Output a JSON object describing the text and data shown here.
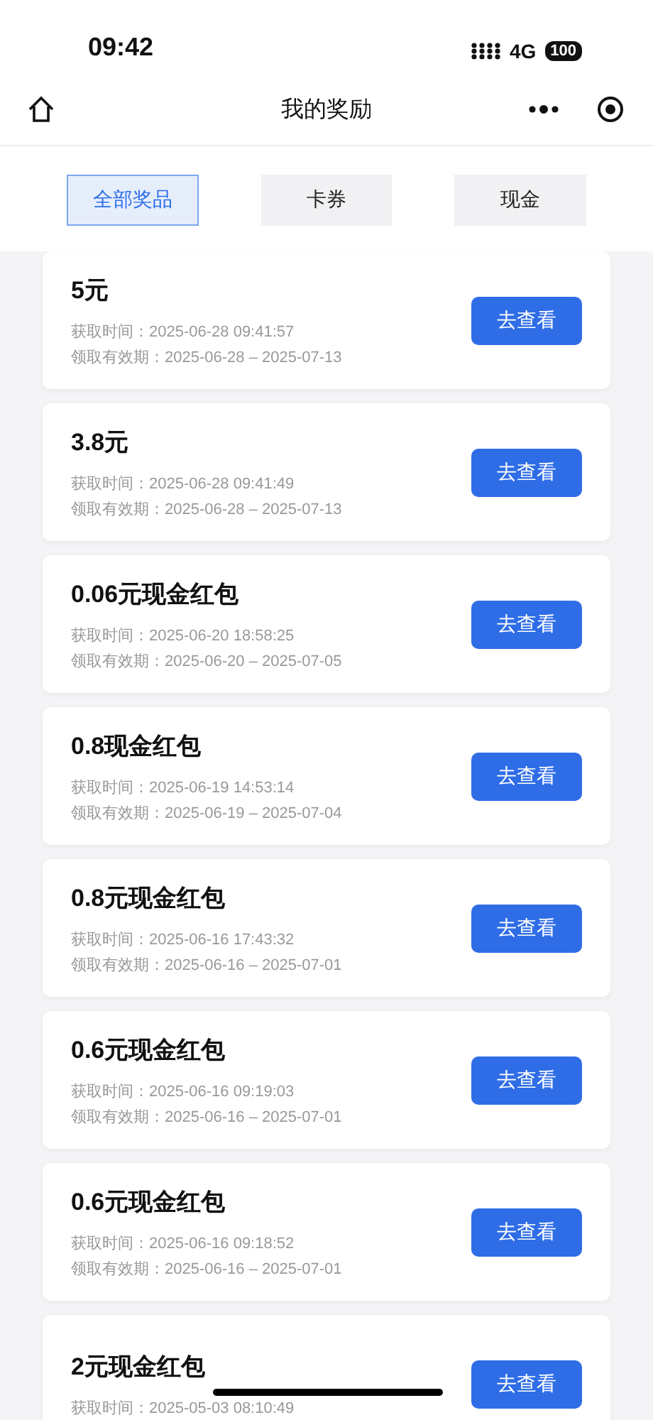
{
  "status_bar": {
    "time": "09:42",
    "network": "4G",
    "battery": "100"
  },
  "nav_bar": {
    "title": "我的奖励"
  },
  "tabs": [
    {
      "label": "全部奖品",
      "selected": true
    },
    {
      "label": "卡券",
      "selected": false
    },
    {
      "label": "现金",
      "selected": false
    }
  ],
  "rewards": [
    {
      "title": "5元",
      "obtained": "获取时间：2025-06-28 09:41:57",
      "validity": "领取有效期：2025-06-28 – 2025-07-13",
      "button": "去查看"
    },
    {
      "title": "3.8元",
      "obtained": "获取时间：2025-06-28 09:41:49",
      "validity": "领取有效期：2025-06-28 – 2025-07-13",
      "button": "去查看"
    },
    {
      "title": "0.06元现金红包",
      "obtained": "获取时间：2025-06-20 18:58:25",
      "validity": "领取有效期：2025-06-20 – 2025-07-05",
      "button": "去查看"
    },
    {
      "title": "0.8现金红包",
      "obtained": "获取时间：2025-06-19 14:53:14",
      "validity": "领取有效期：2025-06-19 – 2025-07-04",
      "button": "去查看"
    },
    {
      "title": "0.8元现金红包",
      "obtained": "获取时间：2025-06-16 17:43:32",
      "validity": "领取有效期：2025-06-16 – 2025-07-01",
      "button": "去查看"
    },
    {
      "title": "0.6元现金红包",
      "obtained": "获取时间：2025-06-16 09:19:03",
      "validity": "领取有效期：2025-06-16 – 2025-07-01",
      "button": "去查看"
    },
    {
      "title": "0.6元现金红包",
      "obtained": "获取时间：2025-06-16 09:18:52",
      "validity": "领取有效期：2025-06-16 – 2025-07-01",
      "button": "去查看"
    },
    {
      "title": "2元现金红包",
      "obtained": "获取时间：2025-05-03 08:10:49",
      "button": "去查看"
    }
  ]
}
